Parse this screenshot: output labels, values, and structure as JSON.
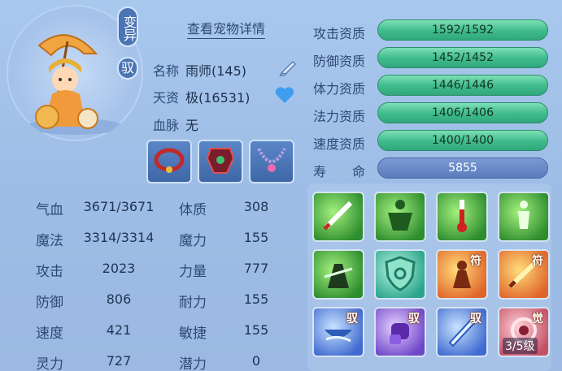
{
  "header": {
    "tag_variant": "变异",
    "tag_yu": "驭",
    "detail_link": "查看宠物详情"
  },
  "info": {
    "name_label": "名称",
    "name_value": "雨师(145)",
    "talent_label": "天资",
    "talent_value": "极(16531)",
    "blood_label": "血脉",
    "blood_value": "无"
  },
  "equipment": [
    {
      "icon": "collar-icon"
    },
    {
      "icon": "armor-icon"
    },
    {
      "icon": "necklace-icon"
    }
  ],
  "stats": {
    "hp_label": "气血",
    "hp_value": "3671/3671",
    "mp_label": "魔法",
    "mp_value": "3314/3314",
    "atk_label": "攻击",
    "atk_value": "2023",
    "def_label": "防御",
    "def_value": "806",
    "spd_label": "速度",
    "spd_value": "421",
    "spirit_label": "灵力",
    "spirit_value": "727",
    "con_label": "体质",
    "con_value": "308",
    "mag_label": "魔力",
    "mag_value": "155",
    "str_label": "力量",
    "str_value": "777",
    "end_label": "耐力",
    "end_value": "155",
    "agi_label": "敏捷",
    "agi_value": "155",
    "pot_label": "潜力",
    "pot_value": "0"
  },
  "aptitudes": {
    "attack_label": "攻击资质",
    "attack_value": "1592/1592",
    "defense_label": "防御资质",
    "defense_value": "1452/1452",
    "stamina_label": "体力资质",
    "stamina_value": "1446/1446",
    "magic_label": "法力资质",
    "magic_value": "1406/1406",
    "speed_label": "速度资质",
    "speed_value": "1400/1400",
    "life_label": "寿　　命",
    "life_value": "5855"
  },
  "skills": {
    "fu": "符",
    "yu": "驭",
    "jue": "觉",
    "level": "3/5级"
  },
  "colors": {
    "bar_green": "#42bd8f",
    "bar_blue": "#5a7cbc",
    "tag_bg": "#4a74b4"
  }
}
